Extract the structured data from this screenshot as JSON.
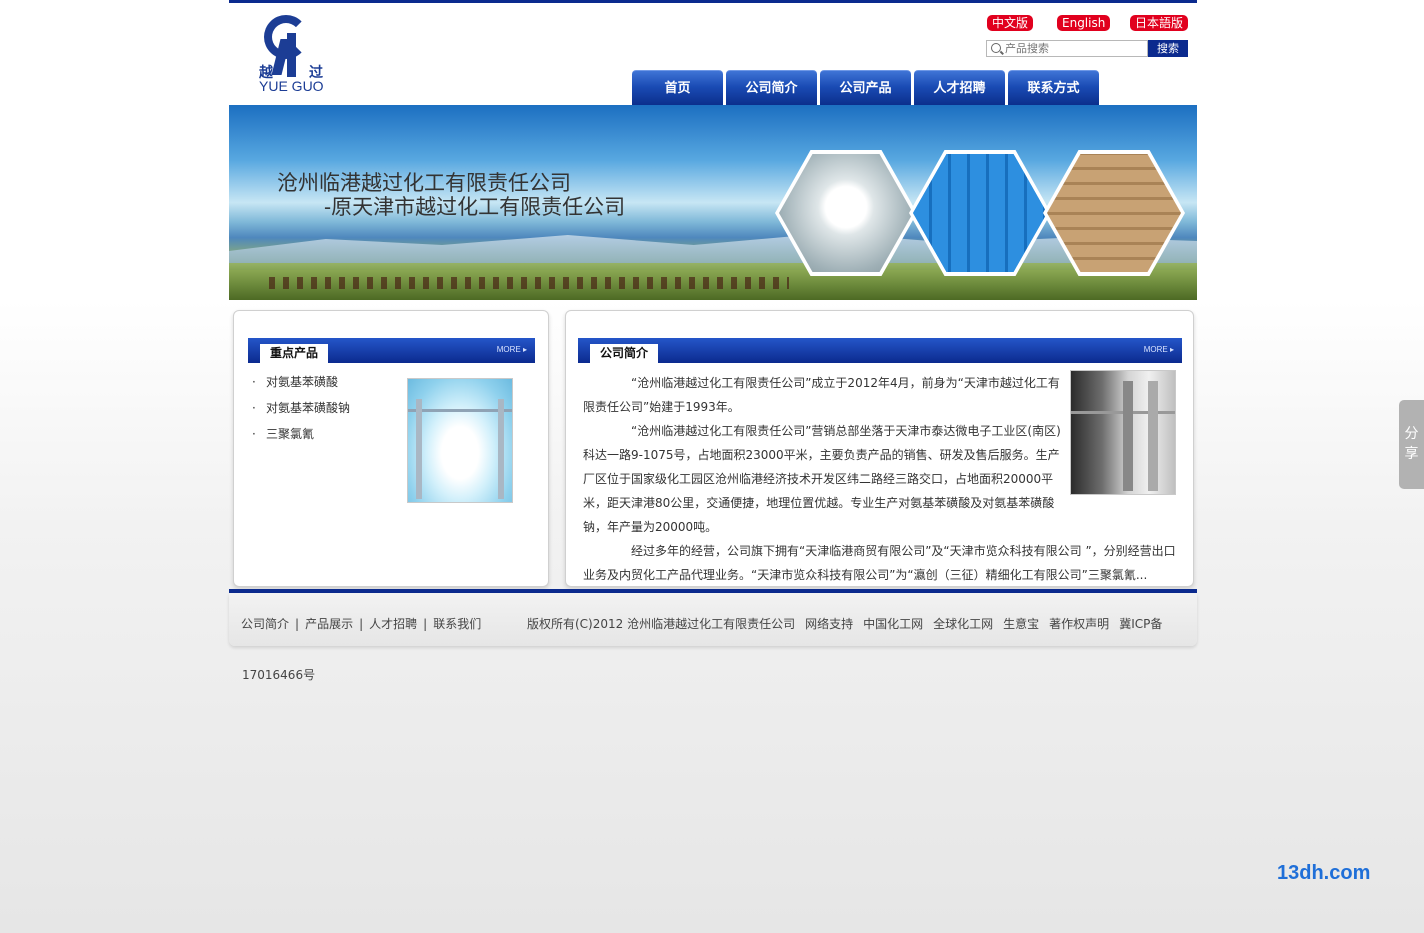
{
  "header": {
    "logo": {
      "cn_left": "越",
      "cn_right": "过",
      "en": "YUE GUO"
    },
    "lang": {
      "cn": "中文版",
      "en": "English",
      "jp": "日本語版"
    },
    "search": {
      "placeholder": "产品搜索",
      "button": "搜索"
    },
    "nav": [
      "首页",
      "公司简介",
      "公司产品",
      "人才招聘",
      "联系方式"
    ]
  },
  "banner": {
    "title1": "沧州临港越过化工有限责任公司",
    "title2": "-原天津市越过化工有限责任公司"
  },
  "products": {
    "tab": "重点产品",
    "more": "MORE ▸",
    "items": [
      "对氨基苯磺酸",
      "对氨基苯磺酸钠",
      "三聚氯氰"
    ]
  },
  "about": {
    "tab": "公司简介",
    "more": "MORE ▸",
    "paragraphs": [
      "“沧州临港越过化工有限责任公司”成立于2012年4月，前身为“天津市越过化工有限责任公司”始建于1993年。",
      "“沧州临港越过化工有限责任公司”营销总部坐落于天津市泰达微电子工业区(南区)科达一路9-1075号，占地面积23000平米，主要负责产品的销售、研发及售后服务。生产厂区位于国家级化工园区沧州临港经济技术开发区纬二路经三路交口，占地面积20000平米，距天津港80公里，交通便捷，地理位置优越。专业生产对氨基苯磺酸及对氨基苯磺酸钠，年产量为20000吨。",
      "经过多年的经营，公司旗下拥有“天津临港商贸有限公司”及“天津市览众科技有限公司 ”，分别经营出口业务及内贸化工产品代理业务。“天津市览众科技有限公司”为“瀛创（三征）精细化工有限公司”三聚氯氰..."
    ]
  },
  "footer": {
    "links": [
      "公司简介",
      "产品展示",
      "人才招聘",
      "联系我们"
    ],
    "separator": "|",
    "copyright": "版权所有(C)2012 沧州临港越过化工有限责任公司",
    "extra": [
      "网络支持",
      "中国化工网",
      "全球化工网",
      "生意宝",
      "著作权声明",
      "冀ICP备"
    ],
    "icp_number": "17016466号"
  },
  "share": {
    "line1": "分",
    "line2": "享"
  },
  "watermark": "13dh.com",
  "colors": {
    "brand_blue": "#0b2a8e",
    "lang_red": "#e1001e",
    "watermark_blue": "#1f6fd8"
  }
}
